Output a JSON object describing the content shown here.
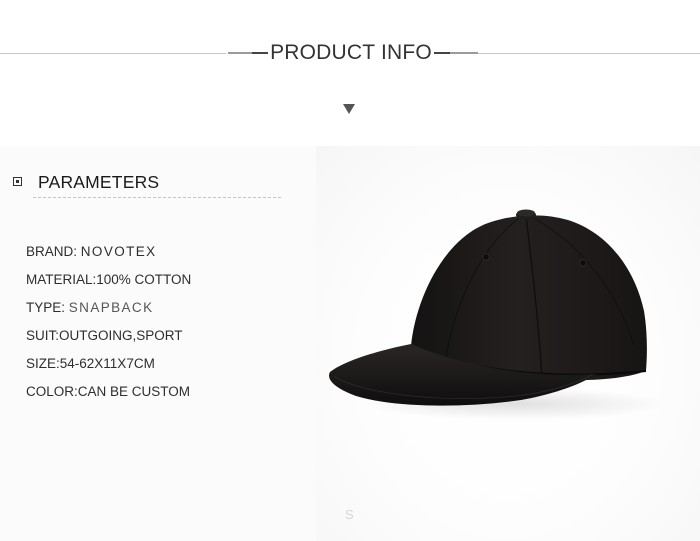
{
  "header": {
    "title": "PRODUCT INFO"
  },
  "parameters": {
    "title": "PARAMETERS",
    "rows": [
      {
        "key": "BRAND: ",
        "value": "NOVOTEX"
      },
      {
        "key": "MATERIAL:",
        "value": "100% COTTON"
      },
      {
        "key": "TYPE: ",
        "value": "SNAPBACK"
      },
      {
        "key": "SUIT:",
        "value": "OUTGOING,SPORT"
      },
      {
        "key": "SIZE:",
        "value": "54-62X11X7CM"
      },
      {
        "key": "COLOR:",
        "value": "CAN BE CUSTOM"
      }
    ]
  },
  "footer": {
    "mark": "S"
  },
  "colors": {
    "text": "#333333",
    "cap": "#1b1918",
    "rule": "#c8c8c8"
  }
}
